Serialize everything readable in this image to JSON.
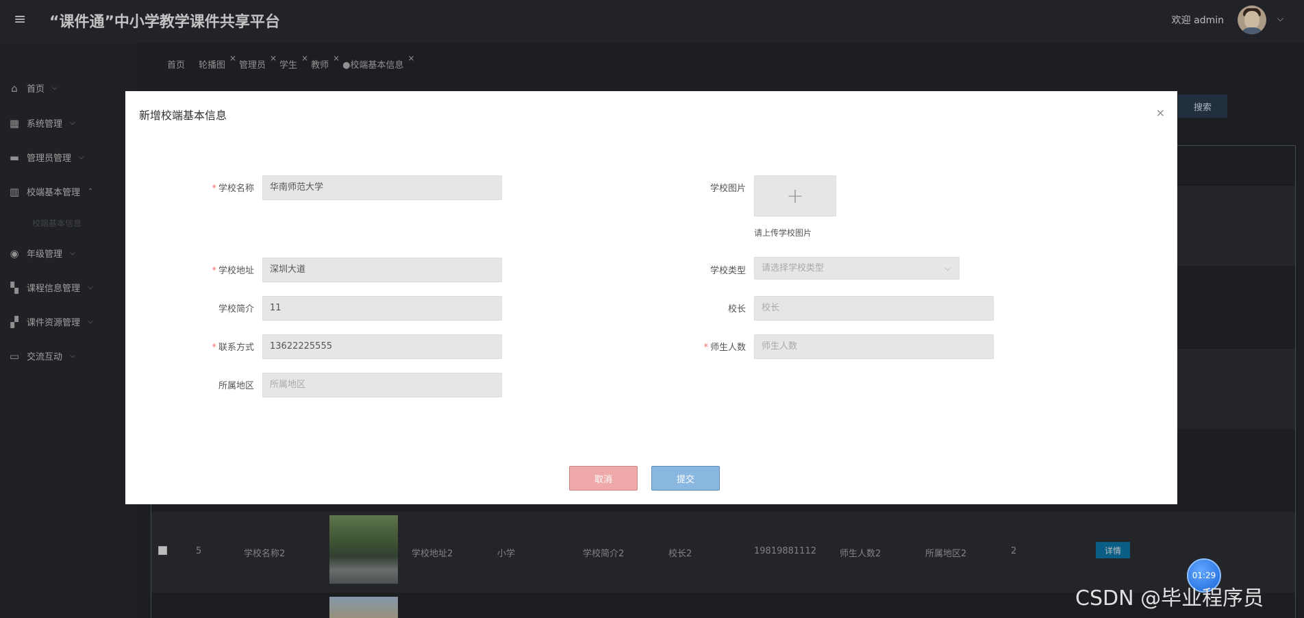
{
  "header": {
    "menu_icon": "hamburger-icon",
    "title": "“课件通”中小学教学课件共享平台",
    "welcome": "欢迎 admin",
    "caret": "⌵"
  },
  "sidebar": {
    "items": [
      {
        "label": "首页",
        "icon": "home-icon",
        "arrow": "⌵"
      },
      {
        "label": "系统管理",
        "icon": "gift-icon",
        "arrow": "⌵"
      },
      {
        "label": "管理员管理",
        "icon": "monitor-icon",
        "arrow": "⌵"
      },
      {
        "label": "校端基本管理",
        "icon": "columns-icon",
        "arrow": "⌃"
      },
      {
        "label": "年级管理",
        "icon": "compass-icon",
        "arrow": "⌵"
      },
      {
        "label": "课程信息管理",
        "icon": "dashboard-icon",
        "arrow": "⌵"
      },
      {
        "label": "课件资源管理",
        "icon": "grid-icon",
        "arrow": "⌵"
      },
      {
        "label": "交流互动",
        "icon": "window-icon",
        "arrow": "⌵"
      }
    ],
    "sub_item": "校端基本信息"
  },
  "tabs": [
    {
      "label": "首页",
      "closable": false
    },
    {
      "label": "轮播图",
      "closable": true
    },
    {
      "label": "管理员",
      "closable": true
    },
    {
      "label": "学生",
      "closable": true
    },
    {
      "label": "教师",
      "closable": true
    },
    {
      "label": "●校端基本信息",
      "closable": true
    }
  ],
  "search_button": "搜索",
  "table_row": {
    "index": "5",
    "name": "学校名称2",
    "address": "学校地址2",
    "type": "小学",
    "intro": "学校简介2",
    "principal": "校长2",
    "phone": "19819881112",
    "count": "师生人数2",
    "region": "所属地区2",
    "extra": "2",
    "detail_button": "详情"
  },
  "timer": "01:29",
  "watermark": "CSDN @毕业程序员",
  "modal": {
    "title": "新增校端基本信息",
    "close": "×",
    "fields": {
      "school_name": {
        "label": "学校名称",
        "required": "*",
        "value": "华南师范大学"
      },
      "school_image": {
        "label": "学校图片",
        "upload_icon": "+",
        "hint": "请上传学校图片"
      },
      "school_address": {
        "label": "学校地址",
        "required": "*",
        "value": "深圳大道"
      },
      "school_type": {
        "label": "学校类型",
        "placeholder": "请选择学校类型"
      },
      "school_intro": {
        "label": "学校简介",
        "value": "11"
      },
      "principal": {
        "label": "校长",
        "placeholder": "校长"
      },
      "contact": {
        "label": "联系方式",
        "required": "*",
        "value": "13622225555"
      },
      "headcount": {
        "label": "师生人数",
        "required": "*",
        "placeholder": "师生人数"
      },
      "region": {
        "label": "所属地区",
        "placeholder": "所属地区"
      }
    },
    "cancel": "取消",
    "submit": "提交"
  }
}
